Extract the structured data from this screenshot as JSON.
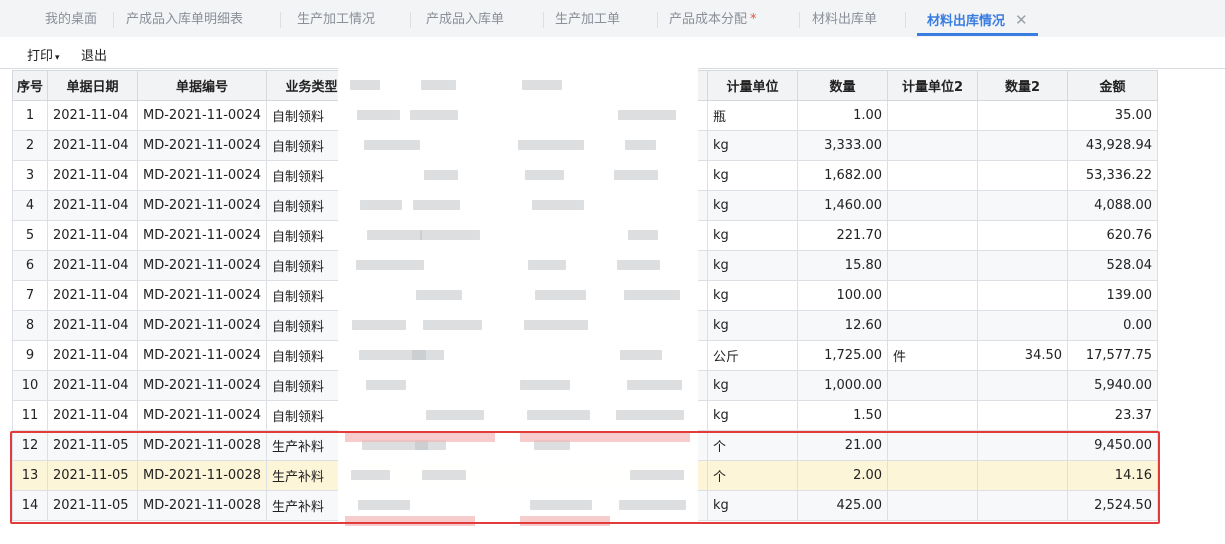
{
  "tabs": [
    {
      "label": "我的桌面"
    },
    {
      "label": "产成品入库单明细表"
    },
    {
      "label": "生产加工情况"
    },
    {
      "label": "产成品入库单"
    },
    {
      "label": "生产加工单"
    },
    {
      "label": "产品成本分配",
      "required": "*"
    },
    {
      "label": "材料出库单"
    },
    {
      "label": "材料出库情况",
      "close": "✕"
    }
  ],
  "toolbar": {
    "print_label": "打印",
    "print_caret": "▾",
    "exit_label": "退出"
  },
  "columns": [
    "序号",
    "单据日期",
    "单据编号",
    "业务类型",
    "",
    "",
    "",
    "计量单位",
    "数量",
    "计量单位2",
    "数量2",
    "金额"
  ],
  "rows": [
    {
      "no": "1",
      "date": "2021-11-04",
      "code": "MD-2021-11-0024",
      "type": "自制领料",
      "unit": "瓶",
      "qty": "1.00",
      "unit2": "",
      "qty2": "",
      "amount": "35.00"
    },
    {
      "no": "2",
      "date": "2021-11-04",
      "code": "MD-2021-11-0024",
      "type": "自制领料",
      "unit": "kg",
      "qty": "3,333.00",
      "unit2": "",
      "qty2": "",
      "amount": "43,928.94"
    },
    {
      "no": "3",
      "date": "2021-11-04",
      "code": "MD-2021-11-0024",
      "type": "自制领料",
      "unit": "kg",
      "qty": "1,682.00",
      "unit2": "",
      "qty2": "",
      "amount": "53,336.22"
    },
    {
      "no": "4",
      "date": "2021-11-04",
      "code": "MD-2021-11-0024",
      "type": "自制领料",
      "unit": "kg",
      "qty": "1,460.00",
      "unit2": "",
      "qty2": "",
      "amount": "4,088.00"
    },
    {
      "no": "5",
      "date": "2021-11-04",
      "code": "MD-2021-11-0024",
      "type": "自制领料",
      "unit": "kg",
      "qty": "221.70",
      "unit2": "",
      "qty2": "",
      "amount": "620.76"
    },
    {
      "no": "6",
      "date": "2021-11-04",
      "code": "MD-2021-11-0024",
      "type": "自制领料",
      "unit": "kg",
      "qty": "15.80",
      "unit2": "",
      "qty2": "",
      "amount": "528.04"
    },
    {
      "no": "7",
      "date": "2021-11-04",
      "code": "MD-2021-11-0024",
      "type": "自制领料",
      "unit": "kg",
      "qty": "100.00",
      "unit2": "",
      "qty2": "",
      "amount": "139.00"
    },
    {
      "no": "8",
      "date": "2021-11-04",
      "code": "MD-2021-11-0024",
      "type": "自制领料",
      "unit": "kg",
      "qty": "12.60",
      "unit2": "",
      "qty2": "",
      "amount": "0.00"
    },
    {
      "no": "9",
      "date": "2021-11-04",
      "code": "MD-2021-11-0024",
      "type": "自制领料",
      "unit": "公斤",
      "qty": "1,725.00",
      "unit2": "件",
      "qty2": "34.50",
      "amount": "17,577.75"
    },
    {
      "no": "10",
      "date": "2021-11-04",
      "code": "MD-2021-11-0024",
      "type": "自制领料",
      "unit": "kg",
      "qty": "1,000.00",
      "unit2": "",
      "qty2": "",
      "amount": "5,940.00"
    },
    {
      "no": "11",
      "date": "2021-11-04",
      "code": "MD-2021-11-0024",
      "type": "自制领料",
      "unit": "kg",
      "qty": "1.50",
      "unit2": "",
      "qty2": "",
      "amount": "23.37"
    },
    {
      "no": "12",
      "date": "2021-11-05",
      "code": "MD-2021-11-0028",
      "type": "生产补料",
      "unit": "个",
      "qty": "21.00",
      "unit2": "",
      "qty2": "",
      "amount": "9,450.00"
    },
    {
      "no": "13",
      "date": "2021-11-05",
      "code": "MD-2021-11-0028",
      "type": "生产补料",
      "unit": "个",
      "qty": "2.00",
      "unit2": "",
      "qty2": "",
      "amount": "14.16"
    },
    {
      "no": "14",
      "date": "2021-11-05",
      "code": "MD-2021-11-0028",
      "type": "生产补料",
      "unit": "kg",
      "qty": "425.00",
      "unit2": "",
      "qty2": "",
      "amount": "2,524.50"
    }
  ],
  "selected_row": "13",
  "colors": {
    "accent": "#3a7de0",
    "highlight_box": "#e23b3b",
    "selected_row_bg": "#fdf5d8"
  }
}
